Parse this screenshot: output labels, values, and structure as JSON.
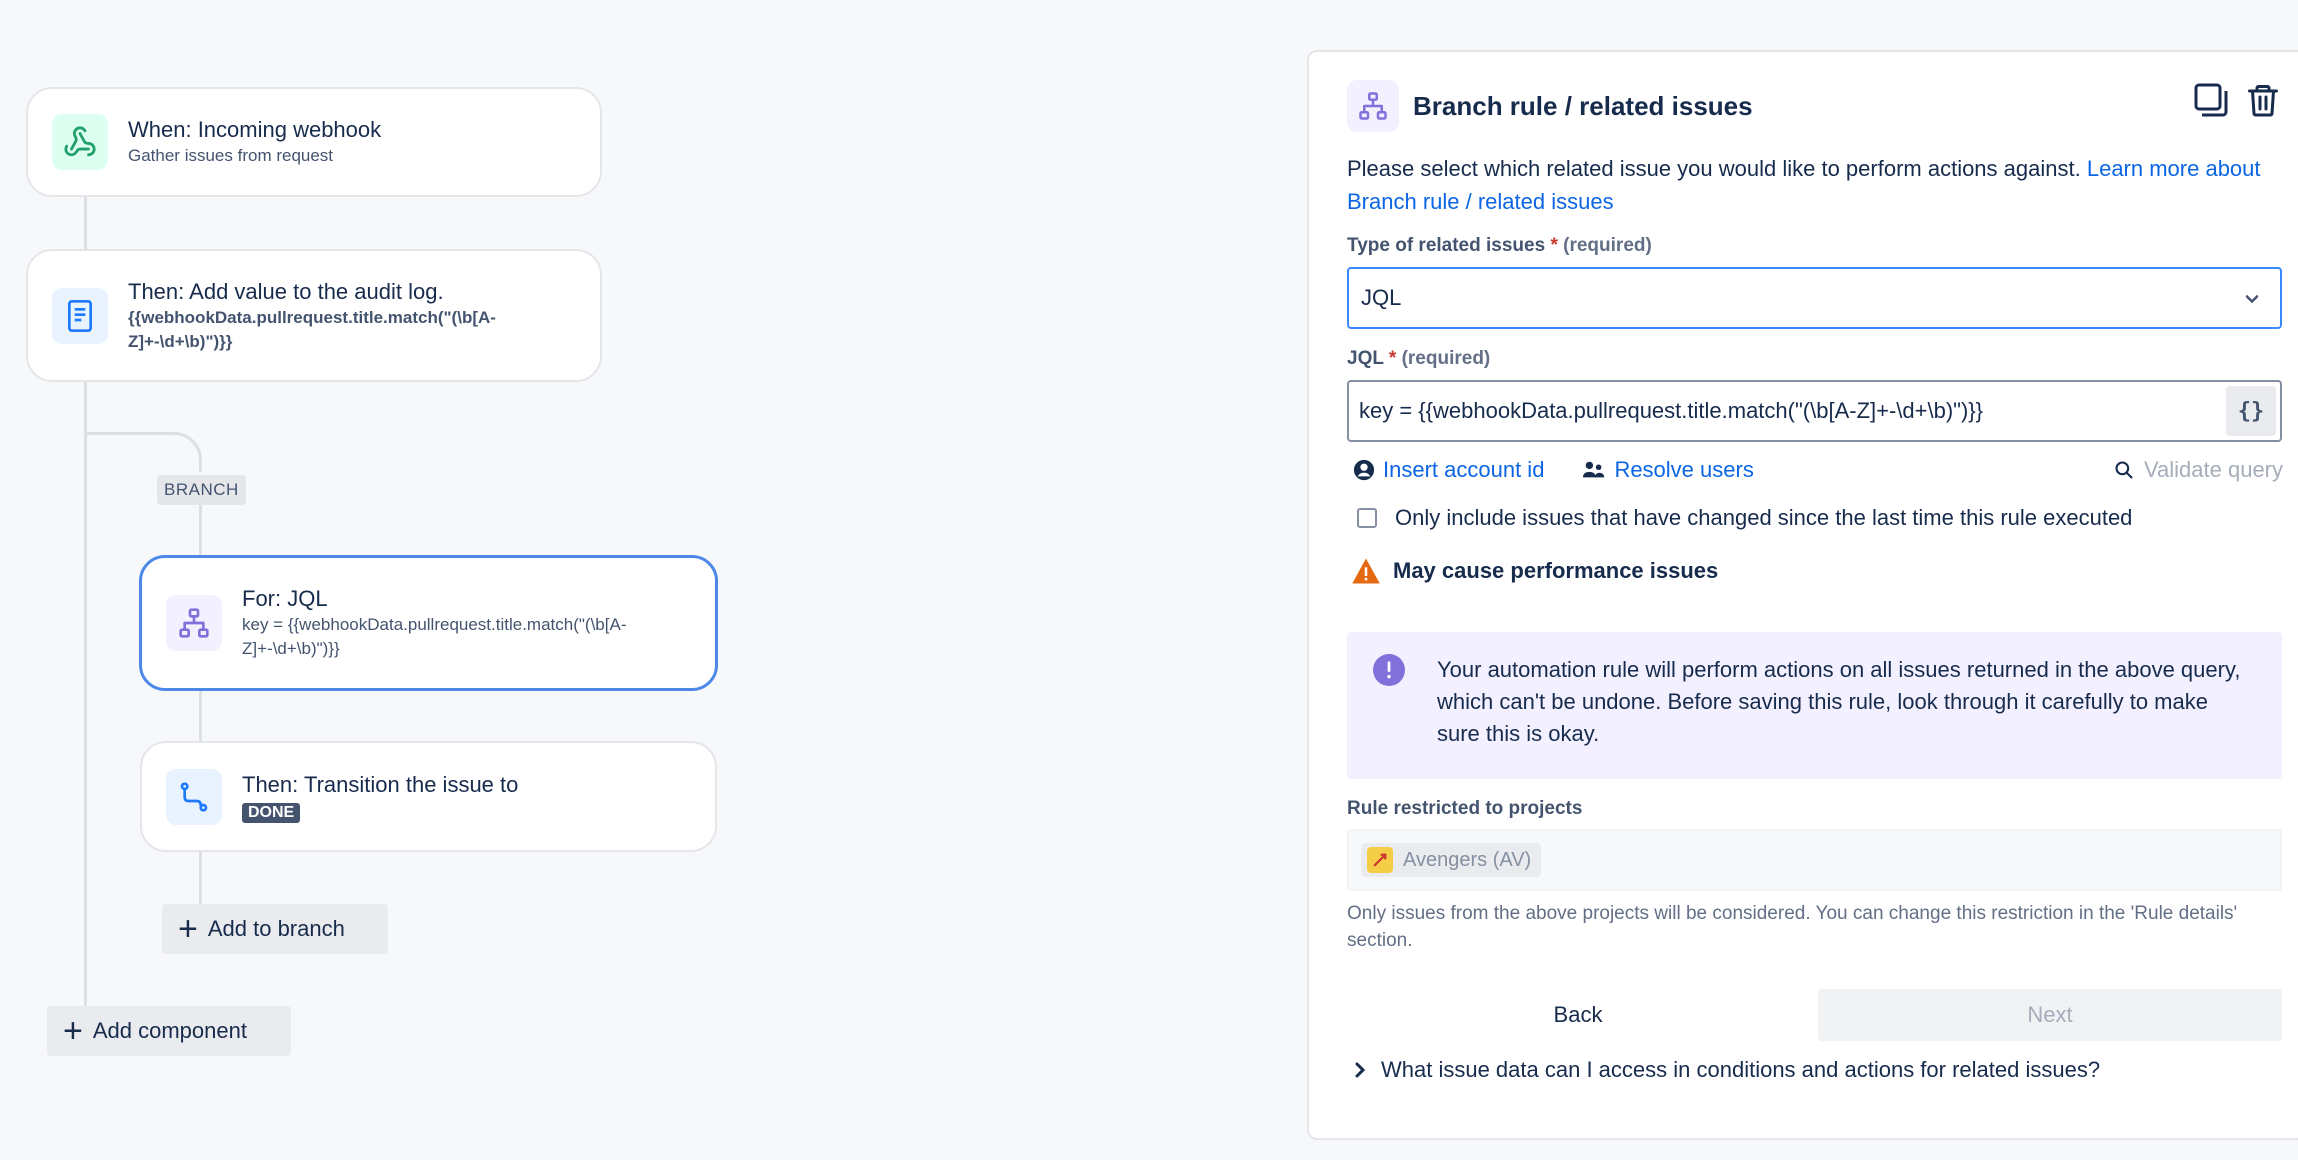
{
  "canvas": {
    "nodes": {
      "trigger": {
        "title": "When: Incoming webhook",
        "sub": "Gather issues from request",
        "icon": "webhook-icon",
        "icon_bg": "#dcfff1",
        "icon_color": "#22a06b"
      },
      "audit": {
        "title": "Then: Add value to the audit log.",
        "sub_line1": "{{webhookData.pullrequest.title.match(\"(\\b[A-",
        "sub_line2": "Z]+-\\d+\\b)\")}}",
        "icon": "document-icon",
        "icon_bg": "#e9f2ff",
        "icon_color": "#1d7afc"
      },
      "branch_for": {
        "title": "For: JQL",
        "sub_line1": "key = {{webhookData.pullrequest.title.match(\"(\\b[A-",
        "sub_line2": "Z]+-\\d+\\b)\")}}",
        "icon": "hierarchy-icon",
        "icon_bg": "#f3f0ff",
        "icon_color": "#8270db"
      },
      "transition": {
        "title": "Then: Transition the issue to",
        "lozenge": "DONE",
        "icon": "transition-icon",
        "icon_bg": "#e9f2ff",
        "icon_color": "#1d7afc"
      }
    },
    "branch_tag": "BRANCH",
    "add_to_branch": "Add to branch",
    "add_component": "Add component"
  },
  "panel": {
    "title": "Branch rule / related issues",
    "description": "Please select which related issue you would like to perform actions against.",
    "learn_more": "Learn more about Branch rule / related issues",
    "type_label": "Type of related issues",
    "required_star": "*",
    "required_text": "(required)",
    "type_value": "JQL",
    "jql_label": "JQL",
    "jql_value": "key = {{webhookData.pullrequest.title.match(\"(\\b[A-Z]+-\\d+\\b)\")}}",
    "brace_button": "{}",
    "insert_account": "Insert account id",
    "resolve_users": "Resolve users",
    "validate_query": "Validate query",
    "checkbox_label": "Only include issues that have changed since the last time this rule executed",
    "warning": "May cause performance issues",
    "info_text": "Your automation rule will perform actions on all issues returned in the above query, which can't be undone. Before saving this rule, look through it carefully to make sure this is okay.",
    "restricted_label": "Rule restricted to projects",
    "project": "Avengers (AV)",
    "helper": "Only issues from the above projects will be considered. You can change this restriction in the 'Rule details' section.",
    "back": "Back",
    "next": "Next",
    "faq": "What issue data can I access in conditions and actions for related issues?"
  },
  "colors": {
    "accent": "#0c66e4",
    "selected_border": "#4c88e8",
    "warning": "#e56910",
    "discovery": "#8270db"
  }
}
